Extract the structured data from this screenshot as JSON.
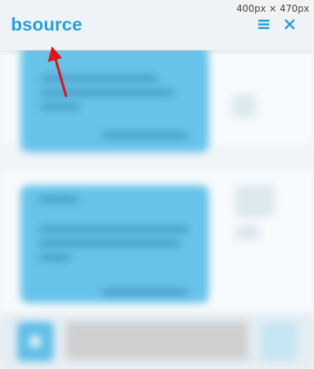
{
  "header": {
    "brand": "bsource"
  },
  "icons": {
    "menu": "hamburger-menu-icon",
    "close": "close-icon"
  },
  "badge": {
    "dimensions": "400px × 470px"
  },
  "colors": {
    "brand": "#2a9fd6",
    "bubble": "#67c3ea",
    "arrow": "#e0141b"
  }
}
